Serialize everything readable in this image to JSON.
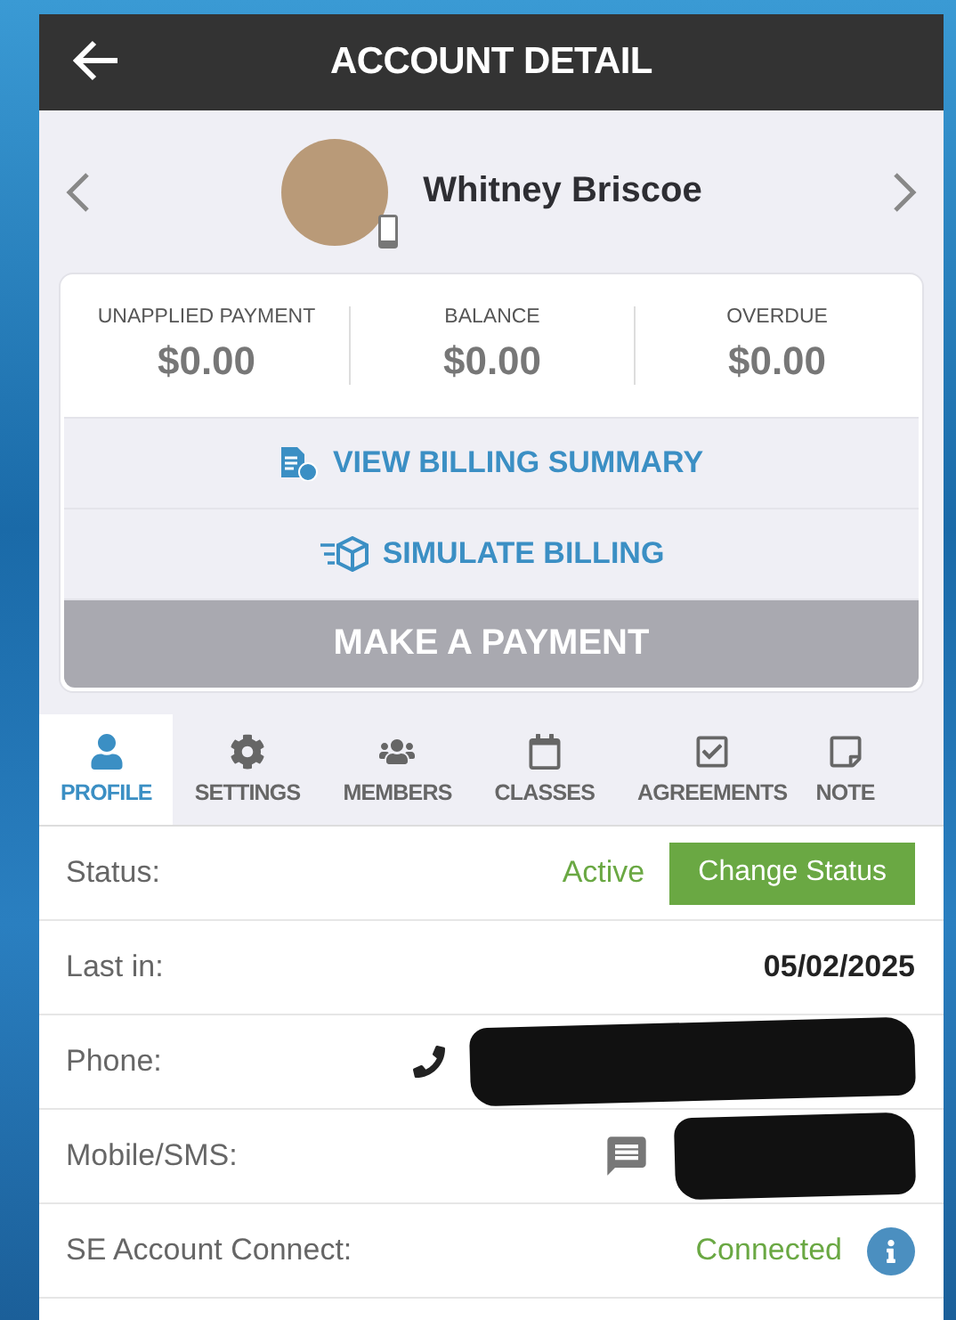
{
  "header": {
    "title": "ACCOUNT DETAIL"
  },
  "profile": {
    "name": "Whitney Briscoe"
  },
  "summary": [
    {
      "label": "UNAPPLIED PAYMENT",
      "value": "$0.00"
    },
    {
      "label": "BALANCE",
      "value": "$0.00"
    },
    {
      "label": "OVERDUE",
      "value": "$0.00"
    }
  ],
  "actions": [
    {
      "kind": "link",
      "label": "VIEW BILLING SUMMARY",
      "disabled": false
    },
    {
      "kind": "link",
      "label": "SIMULATE BILLING",
      "disabled": false
    },
    {
      "kind": "primary",
      "label": "MAKE A PAYMENT",
      "disabled": true
    }
  ],
  "tabs": [
    {
      "label": "PROFILE",
      "selected": true
    },
    {
      "label": "SETTINGS",
      "selected": false
    },
    {
      "label": "MEMBERS",
      "selected": false
    },
    {
      "label": "CLASSES",
      "selected": false
    },
    {
      "label": "AGREEMENTS",
      "selected": false
    },
    {
      "label": "NOTE",
      "selected": false
    }
  ],
  "details": [
    {
      "kind": "status",
      "label": "Status:",
      "value": "Active",
      "button": "Change Status"
    },
    {
      "kind": "text",
      "label": "Last in:",
      "value": "05/02/2025"
    },
    {
      "kind": "phone",
      "label": "Phone:",
      "redacted": true
    },
    {
      "kind": "sms",
      "label": "Mobile/SMS:",
      "redacted": true
    },
    {
      "kind": "connect",
      "label": "SE Account Connect:",
      "value": "Connected"
    }
  ]
}
